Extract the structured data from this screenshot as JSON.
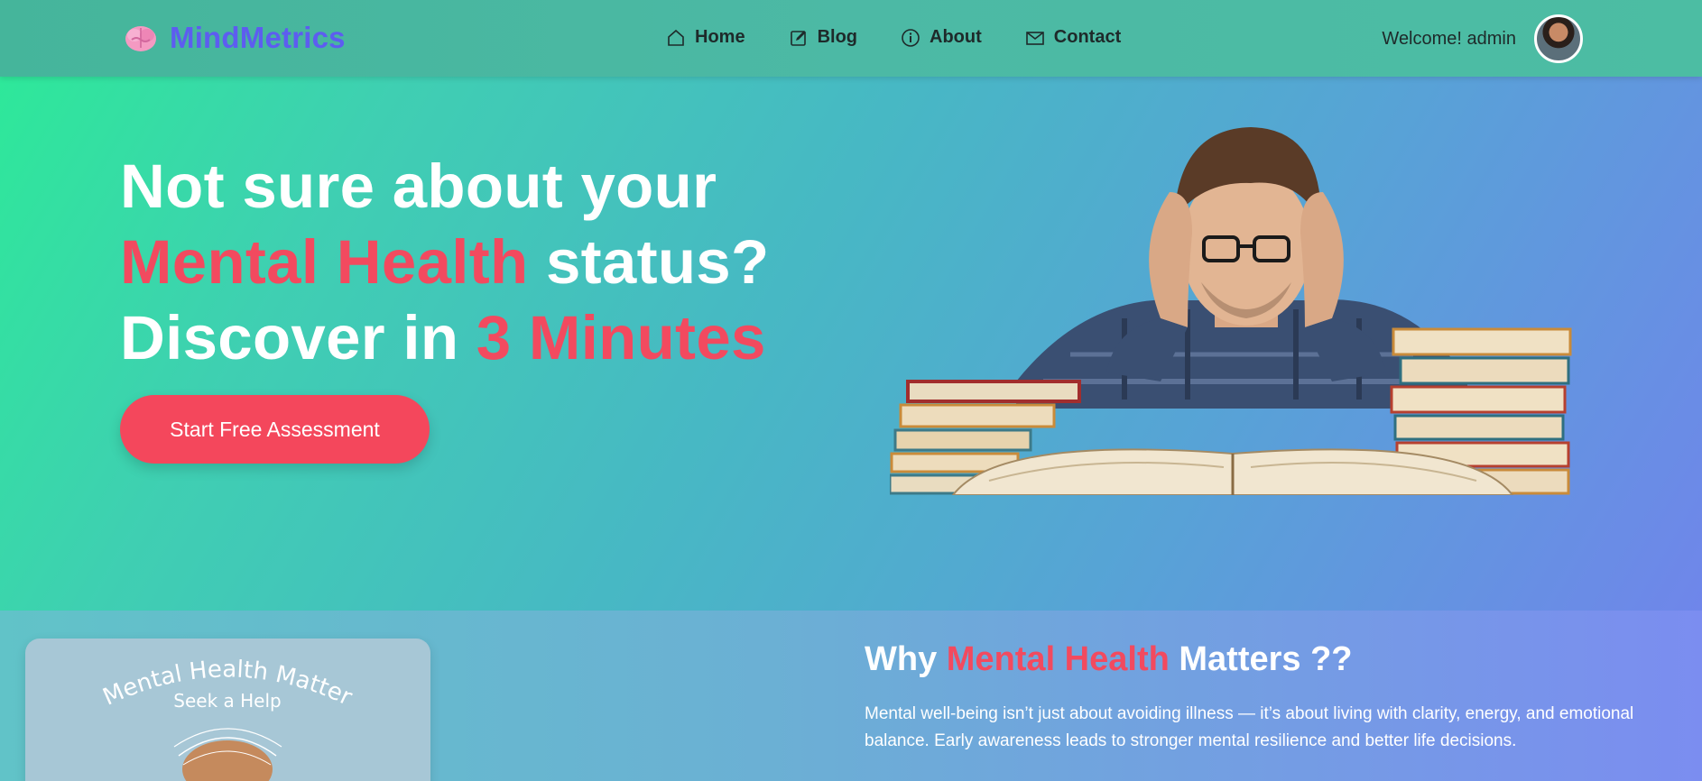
{
  "brand": {
    "name": "MindMetrics",
    "icon": "brain-icon",
    "color": "#5d5df0"
  },
  "nav": {
    "items": [
      {
        "label": "Home",
        "icon": "home-icon"
      },
      {
        "label": "Blog",
        "icon": "edit-icon"
      },
      {
        "label": "About",
        "icon": "info-icon"
      },
      {
        "label": "Contact",
        "icon": "envelope-icon"
      }
    ]
  },
  "user": {
    "welcome": "Welcome! admin"
  },
  "hero": {
    "line1": "Not sure about your",
    "line2_accent": "Mental Health",
    "line2_rest": " status?",
    "line3_start": "Discover in ",
    "line3_accent": "3 Minutes",
    "cta_label": "Start Free Assessment",
    "accent_color": "#f24a5f"
  },
  "poster": {
    "title": "Mental Health Matter",
    "subtitle": "Seek a Help"
  },
  "why": {
    "title_start": "Why ",
    "title_accent": "Mental Health",
    "title_end": " Matters ??",
    "body": "Mental well-being isn’t just about avoiding illness — it’s about living with clarity, energy, and emotional balance. Early awareness leads to stronger mental resilience and better life decisions."
  }
}
